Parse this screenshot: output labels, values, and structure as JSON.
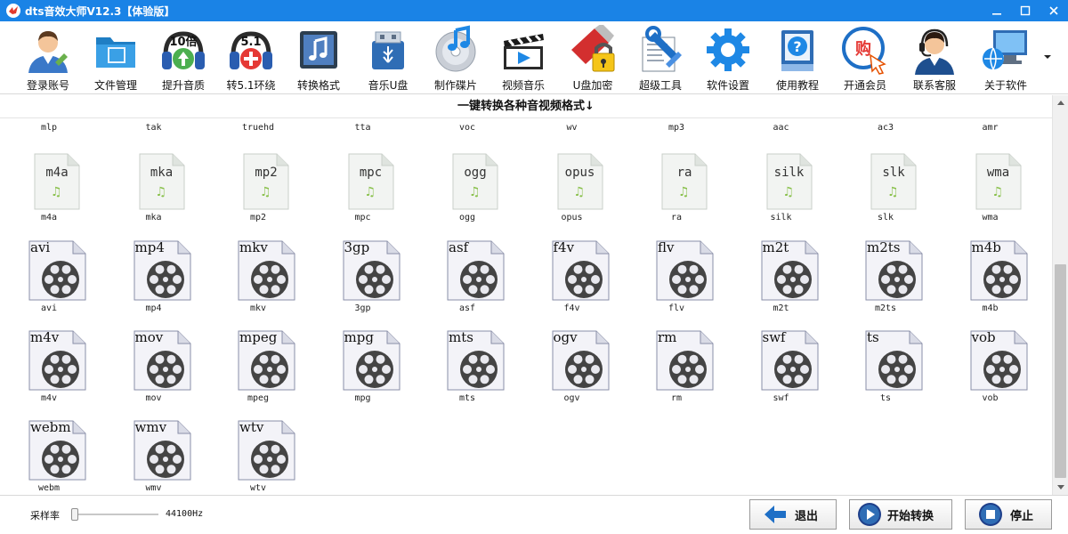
{
  "window": {
    "title": "dts音效大师V12.3【体验版】"
  },
  "toolbar": {
    "items": [
      {
        "label": "登录账号",
        "icon": "user-login-icon"
      },
      {
        "label": "文件管理",
        "icon": "folder-icon"
      },
      {
        "label": "提升音质",
        "icon": "headphones-10x-icon",
        "badge": "10倍"
      },
      {
        "label": "转5.1环绕",
        "icon": "headphones-51-icon",
        "badge": "5.1"
      },
      {
        "label": "转换格式",
        "icon": "music-note-icon"
      },
      {
        "label": "音乐U盘",
        "icon": "usb-drive-icon"
      },
      {
        "label": "制作碟片",
        "icon": "cd-disc-icon"
      },
      {
        "label": "视频音乐",
        "icon": "clapperboard-icon"
      },
      {
        "label": "U盘加密",
        "icon": "usb-lock-icon"
      },
      {
        "label": "超级工具",
        "icon": "tools-icon"
      },
      {
        "label": "软件设置",
        "icon": "gear-icon"
      },
      {
        "label": "使用教程",
        "icon": "help-book-icon"
      },
      {
        "label": "开通会员",
        "icon": "vip-cart-icon",
        "badge": "购"
      },
      {
        "label": "联系客服",
        "icon": "headset-agent-icon"
      },
      {
        "label": "关于软件",
        "icon": "computer-globe-icon"
      }
    ]
  },
  "caption": "一键转换各种音视频格式↓",
  "formats": {
    "top_row": [
      "mlp",
      "tak",
      "truehd",
      "tta",
      "voc",
      "wv",
      "mp3",
      "aac",
      "ac3",
      "amr"
    ],
    "audio_row": [
      "m4a",
      "mka",
      "mp2",
      "mpc",
      "ogg",
      "opus",
      "ra",
      "silk",
      "slk",
      "wma"
    ],
    "video_row1": [
      "avi",
      "mp4",
      "mkv",
      "3gp",
      "asf",
      "f4v",
      "flv",
      "m2t",
      "m2ts",
      "m4b"
    ],
    "video_row2": [
      "m4v",
      "mov",
      "mpeg",
      "mpg",
      "mts",
      "ogv",
      "rm",
      "swf",
      "ts",
      "vob"
    ],
    "video_row3": [
      "webm",
      "wmv",
      "wtv"
    ]
  },
  "bottom": {
    "sample_rate_label": "采样率",
    "sample_rate_value": "44100Hz",
    "slider_level": 0,
    "exit_label": "退出",
    "start_label": "开始转换",
    "stop_label": "停止"
  },
  "colors": {
    "titlebar": "#1a83e6",
    "audio_note": "#88c04a",
    "reel": "#444444"
  }
}
